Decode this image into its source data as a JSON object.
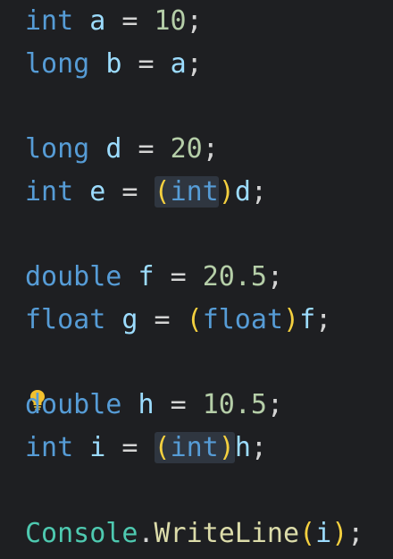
{
  "code": {
    "line1": {
      "type": "int",
      "name": "a",
      "eq": "=",
      "value": "10",
      "semi": ";"
    },
    "line2": {
      "type": "long",
      "name": "b",
      "eq": "=",
      "value": "a",
      "semi": ";"
    },
    "line3": {
      "type": "long",
      "name": "d",
      "eq": "=",
      "value": "20",
      "semi": ";"
    },
    "line4": {
      "type": "int",
      "name": "e",
      "eq": "=",
      "open": "(",
      "cast": "int",
      "close": ")",
      "value": "d",
      "semi": ";"
    },
    "line5": {
      "type": "double",
      "name": "f",
      "eq": "=",
      "value": "20.5",
      "semi": ";"
    },
    "line6": {
      "type": "float",
      "name": "g",
      "eq": "=",
      "open": "(",
      "cast": "float",
      "close": ")",
      "value": "f",
      "semi": ";"
    },
    "line7": {
      "type": "double",
      "name": "h",
      "eq": "=",
      "value": "10.5",
      "semi": ";"
    },
    "line8": {
      "type": "int",
      "name": "i",
      "eq": "=",
      "open": "(",
      "cast": "int",
      "close": ")",
      "value": "h",
      "semi": ";"
    },
    "line9": {
      "cls": "Console",
      "dot": ".",
      "method": "WriteLine",
      "open": "(",
      "arg": "i",
      "close": ")",
      "semi": ";"
    }
  },
  "colors": {
    "background": "#1e1f22",
    "keyword": "#569cd6",
    "variable": "#9cdcfe",
    "number": "#b5cea8",
    "paren": "#f4d03f",
    "class": "#4ec9b0",
    "method": "#dcdcaa"
  },
  "icons": {
    "lightbulb": "lightbulb-icon"
  }
}
